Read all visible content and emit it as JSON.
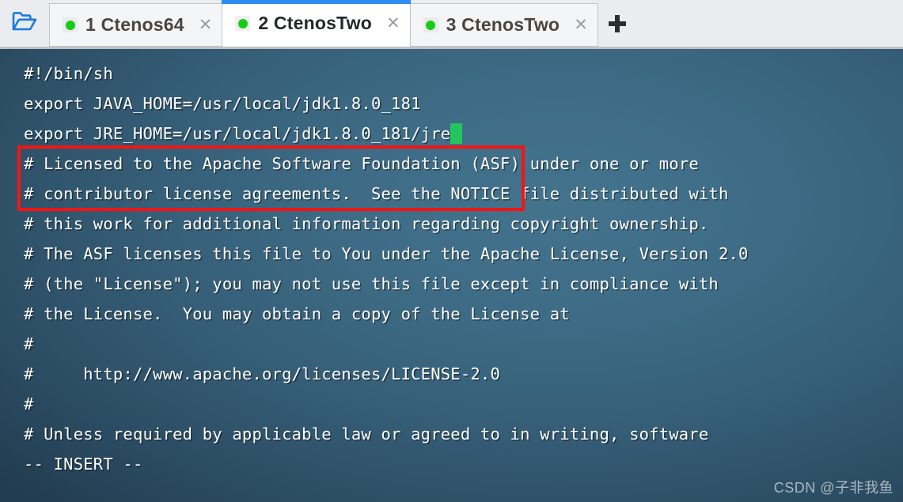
{
  "titlebar": {
    "folder_icon": "open-folder-icon",
    "add_tab_icon": "plus-icon",
    "close_icon": "close-icon",
    "tabs": [
      {
        "label": "1 Ctenos64",
        "status_dot": "green-status-dot",
        "close": "✕",
        "active": false
      },
      {
        "label": "2 CtenosTwo",
        "status_dot": "green-status-dot",
        "close": "✕",
        "active": true
      },
      {
        "label": "3 CtenosTwo",
        "status_dot": "green-status-dot",
        "close": "✕",
        "active": false
      }
    ],
    "add_tab_label": "+"
  },
  "terminal": {
    "lines": [
      "#!/bin/sh",
      "export JAVA_HOME=/usr/local/jdk1.8.0_181",
      "export JRE_HOME=/usr/local/jdk1.8.0_181/jre",
      "# Licensed to the Apache Software Foundation (ASF) under one or more",
      "# contributor license agreements.  See the NOTICE file distributed with",
      "# this work for additional information regarding copyright ownership.",
      "# The ASF licenses this file to You under the Apache License, Version 2.0",
      "# (the \"License\"); you may not use this file except in compliance with",
      "# the License.  You may obtain a copy of the License at",
      "#",
      "#     http://www.apache.org/licenses/LICENSE-2.0",
      "#",
      "# Unless required by applicable law or agreed to in writing, software",
      "-- INSERT --"
    ],
    "cursor": {
      "visible": true,
      "color": "#22c55e",
      "line_index": 2
    },
    "highlight_box": {
      "color": "#f51414",
      "covers_lines": [
        1,
        2
      ]
    },
    "status_mode": "-- INSERT --",
    "background_color": "#3e6c86",
    "text_color": "#ffffff"
  },
  "watermark": {
    "text": "CSDN @子非我鱼"
  }
}
